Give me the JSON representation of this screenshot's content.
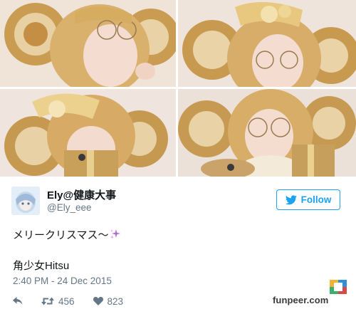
{
  "tweet": {
    "display_name": "Ely@健康大事",
    "handle": "@Ely_eee",
    "follow_label": "Follow",
    "text_line1": "メリークリスマス〜",
    "text_line2": "角少女Hitsu",
    "timestamp": "2:40 PM - 24 Dec 2015",
    "retweet_count": "456",
    "like_count": "823"
  },
  "icons": {
    "follow": "twitter-bird-icon",
    "reply": "reply-icon",
    "retweet": "retweet-icon",
    "like": "heart-icon",
    "emoji": "sparkles-emoji"
  },
  "watermark": {
    "text": "funpeer.com"
  },
  "colors": {
    "accent": "#1da1f2",
    "text": "#14171a",
    "muted": "#657786",
    "sparkle": "#b36bd8"
  }
}
